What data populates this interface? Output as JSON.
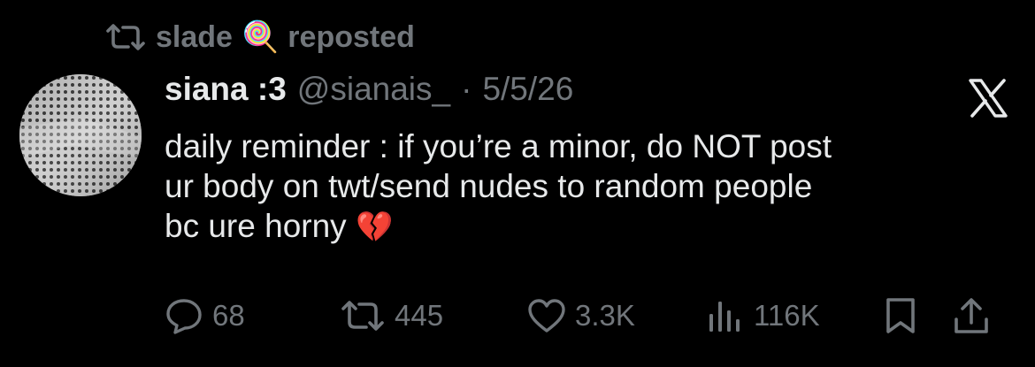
{
  "repost": {
    "user": "slade",
    "emoji": "🍭",
    "label": "reposted"
  },
  "tweet": {
    "author_name": "siana :3",
    "handle": "@sianais_",
    "separator": "·",
    "date": "5/5/26",
    "text_lines": [
      "daily reminder : if you’re a minor, do NOT post",
      "ur body on twt/send nudes to random people",
      "bc ure horny"
    ],
    "text_emoji": "💔"
  },
  "actions": {
    "replies": "68",
    "reposts": "445",
    "likes": "3.3K",
    "views": "116K"
  },
  "colors": {
    "background": "#000000",
    "text": "#e7e9ea",
    "muted": "#71767b"
  },
  "icons": [
    "repost-icon",
    "lollipop-emoji",
    "x-logo-icon",
    "reply-icon",
    "retweet-icon",
    "like-icon",
    "views-icon",
    "bookmark-icon",
    "share-icon"
  ]
}
